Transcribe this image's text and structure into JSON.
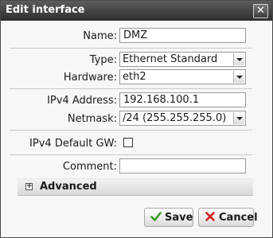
{
  "dialog": {
    "title": "Edit interface",
    "close_glyph": "✕"
  },
  "fields": {
    "name": {
      "label": "Name:",
      "value": "DMZ"
    },
    "type": {
      "label": "Type:",
      "value": "Ethernet Standard"
    },
    "hardware": {
      "label": "Hardware:",
      "value": "eth2"
    },
    "ipv4_address": {
      "label": "IPv4 Address:",
      "value": "192.168.100.1"
    },
    "netmask": {
      "label": "Netmask:",
      "value": "/24 (255.255.255.0)"
    },
    "ipv4_default_gw": {
      "label": "IPv4 Default GW:",
      "checked": false
    },
    "comment": {
      "label": "Comment:",
      "value": ""
    }
  },
  "advanced": {
    "label": "Advanced",
    "expand_glyph": "+"
  },
  "buttons": {
    "save": {
      "label": "Save",
      "icon": "check-icon",
      "icon_color": "#3a9d23"
    },
    "cancel": {
      "label": "Cancel",
      "icon": "x-icon",
      "icon_color": "#d11f1f"
    }
  },
  "colors": {
    "titlebar": "#3b3b3b",
    "dialog_bg": "#f7f7f7"
  }
}
